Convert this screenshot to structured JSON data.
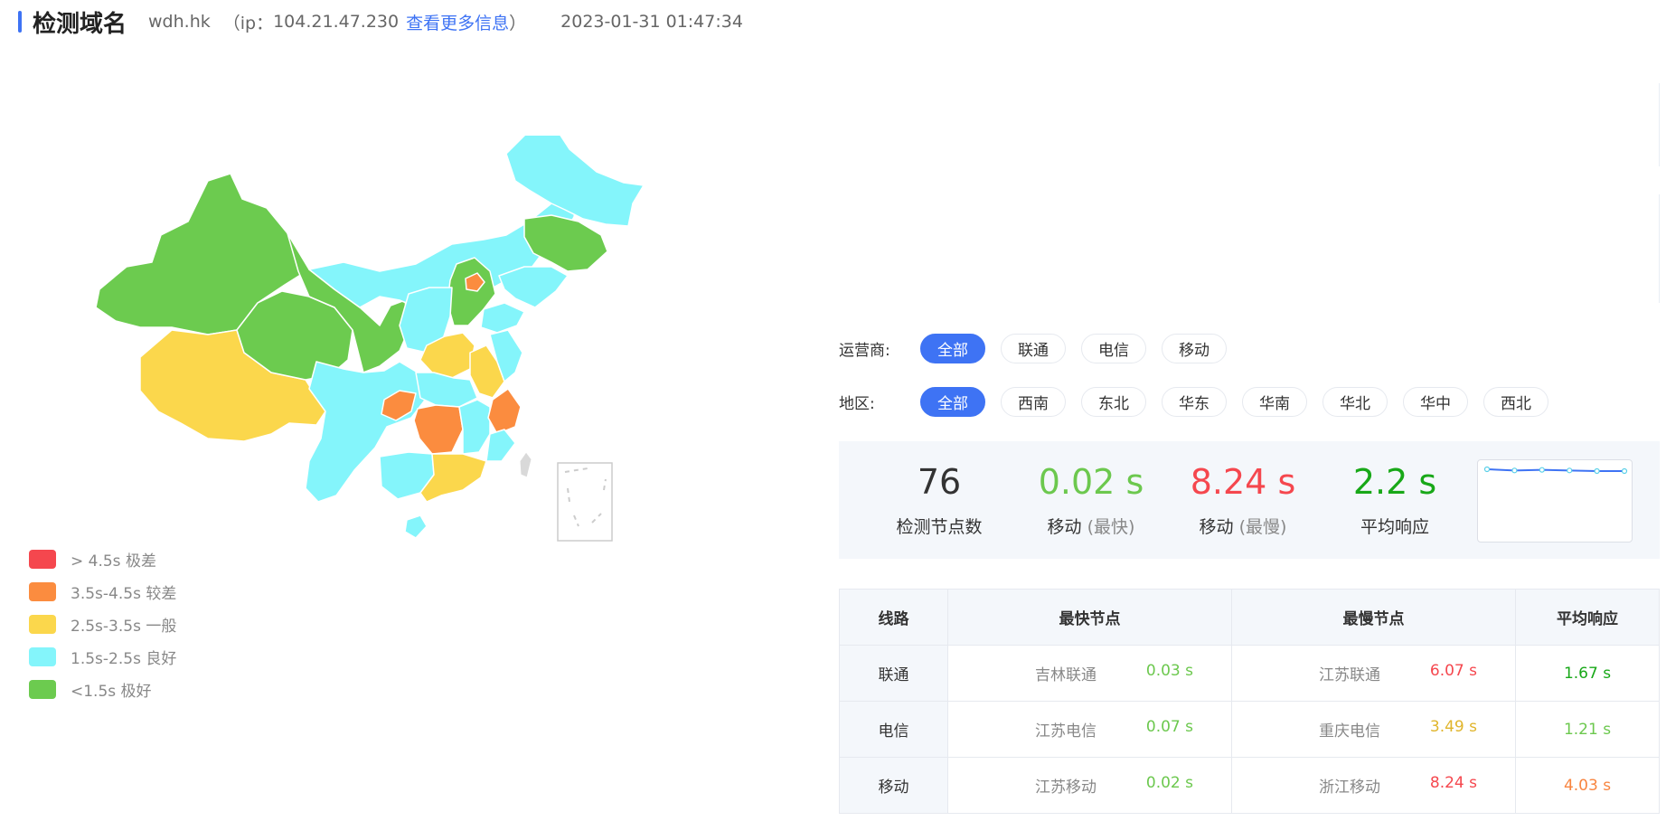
{
  "header": {
    "title": "检测域名",
    "domain": "wdh.hk",
    "ip_prefix": "（ip：",
    "ip": "104.21.47.230",
    "more_link": "查看更多信息",
    "ip_suffix": "）",
    "timestamp": "2023-01-31 01:47:34"
  },
  "legend": [
    {
      "label": "> 4.5s 极差",
      "color": "#f5474e"
    },
    {
      "label": "3.5s-4.5s 较差",
      "color": "#fb8c3f"
    },
    {
      "label": "2.5s-3.5s 一般",
      "color": "#fbd74c"
    },
    {
      "label": "1.5s-2.5s 良好",
      "color": "#84f5fb"
    },
    {
      "label": "<1.5s 极好",
      "color": "#6ccb4f"
    }
  ],
  "filters": {
    "carrier": {
      "label": "运营商:",
      "options": [
        "全部",
        "联通",
        "电信",
        "移动"
      ],
      "active": "全部"
    },
    "region": {
      "label": "地区:",
      "options": [
        "全部",
        "西南",
        "东北",
        "华东",
        "华南",
        "华北",
        "华中",
        "西北"
      ],
      "active": "全部"
    }
  },
  "stats": {
    "node_count": {
      "value": "76",
      "label": "检测节点数"
    },
    "fastest": {
      "value": "0.02 s",
      "label": "移动",
      "sub": "(最快)"
    },
    "slowest": {
      "value": "8.24 s",
      "label": "移动",
      "sub": "(最慢)"
    },
    "average": {
      "value": "2.2 s",
      "label": "平均响应"
    },
    "sparkline": [
      2.3,
      2.2,
      2.25,
      2.2,
      2.15,
      2.15
    ]
  },
  "table": {
    "headers": [
      "线路",
      "最快节点",
      "最慢节点",
      "平均响应"
    ],
    "rows": [
      {
        "line": "联通",
        "fast_node": "吉林联通",
        "fast_time": "0.03 s",
        "slow_node": "江苏联通",
        "slow_time": "6.07 s",
        "avg": "1.67 s"
      },
      {
        "line": "电信",
        "fast_node": "江苏电信",
        "fast_time": "0.07 s",
        "slow_node": "重庆电信",
        "slow_time": "3.49 s",
        "avg": "1.21 s"
      },
      {
        "line": "移动",
        "fast_node": "江苏移动",
        "fast_time": "0.02 s",
        "slow_node": "浙江移动",
        "slow_time": "8.24 s",
        "avg": "4.03 s"
      }
    ]
  },
  "colors": {
    "accent": "#3e73f4",
    "excellent": "#6ccb4f",
    "good": "#84f5fb",
    "fair": "#fbd74c",
    "poor": "#fb8c3f",
    "bad": "#f5474e"
  }
}
